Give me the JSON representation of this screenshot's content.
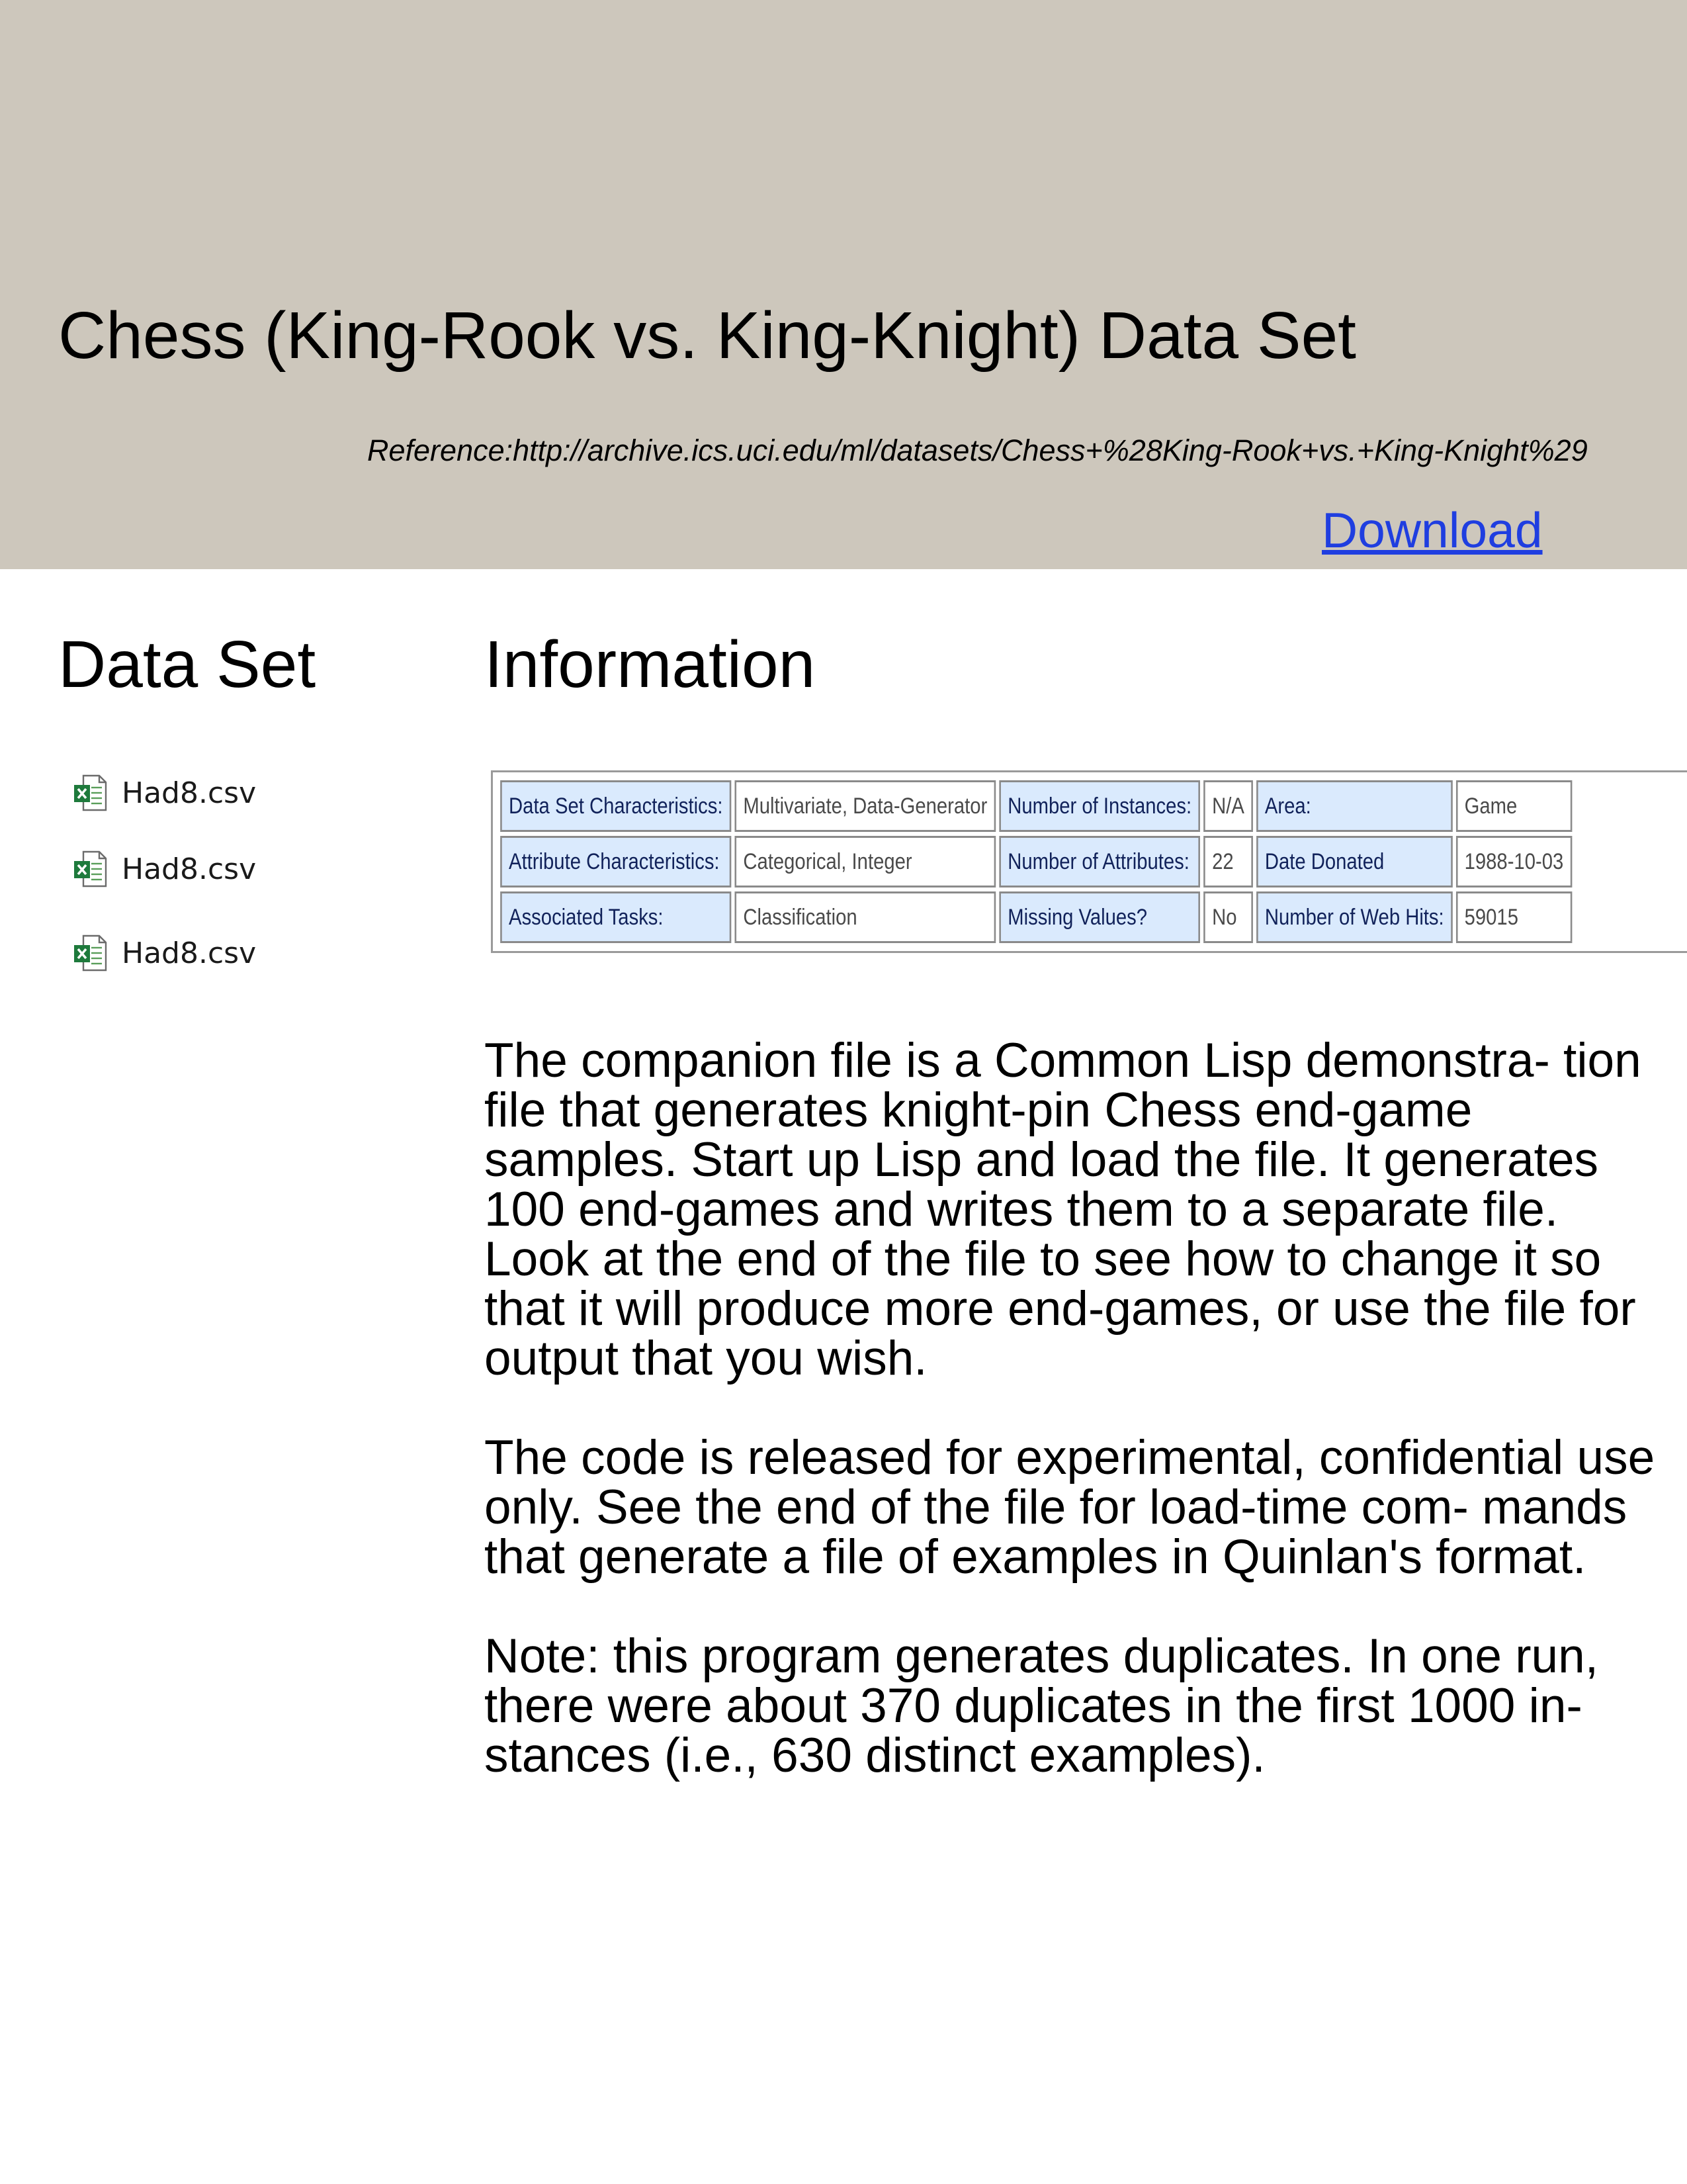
{
  "header": {
    "title": "Chess (King-Rook vs. King-Knight) Data Set",
    "reference": "Reference:http://archive.ics.uci.edu/ml/datasets/Chess+%28King-Rook+vs.+King-Knight%29",
    "download_label": "Download",
    "background_color": "#cdc7bc",
    "link_color": "#1f3ee0"
  },
  "columns": {
    "left_heading": "Data Set",
    "right_heading": "Information"
  },
  "files": [
    {
      "name": "Had8.csv",
      "icon": "excel-file-icon"
    },
    {
      "name": "Had8.csv",
      "icon": "excel-file-icon"
    },
    {
      "name": "Had8.csv",
      "icon": "excel-file-icon"
    }
  ],
  "info_table": {
    "rows": [
      [
        {
          "key": "Data Set Characteristics:",
          "value": "Multivariate, Data-Generator"
        },
        {
          "key": "Number of Instances:",
          "value": "N/A"
        },
        {
          "key": "Area:",
          "value": "Game"
        }
      ],
      [
        {
          "key": "Attribute Characteristics:",
          "value": "Categorical, Integer"
        },
        {
          "key": "Number of Attributes:",
          "value": "22"
        },
        {
          "key": "Date Donated",
          "value": "1988-10-03"
        }
      ],
      [
        {
          "key": "Associated Tasks:",
          "value": "Classification"
        },
        {
          "key": "Missing Values?",
          "value": "No"
        },
        {
          "key": "Number of Web Hits:",
          "value": "59015"
        }
      ]
    ],
    "key_background": "#daeafd"
  },
  "description": {
    "paragraphs": [
      "The companion file is a Common Lisp demonstra- tion file that generates knight-pin Chess end-game samples. Start up Lisp and load the file. It generates 100 end-games and writes them to a separate file. Look at the end of the file to see how to change it so that it will produce more end-games, or use the file for output that you wish.",
      "The code is released for experimental, confidential use only. See the end of the file for load-time com- mands that generate a file of examples in Quinlan's format.",
      "Note: this program generates duplicates. In one run, there were about 370 duplicates in the first 1000 in- stances (i.e., 630 distinct examples)."
    ]
  }
}
